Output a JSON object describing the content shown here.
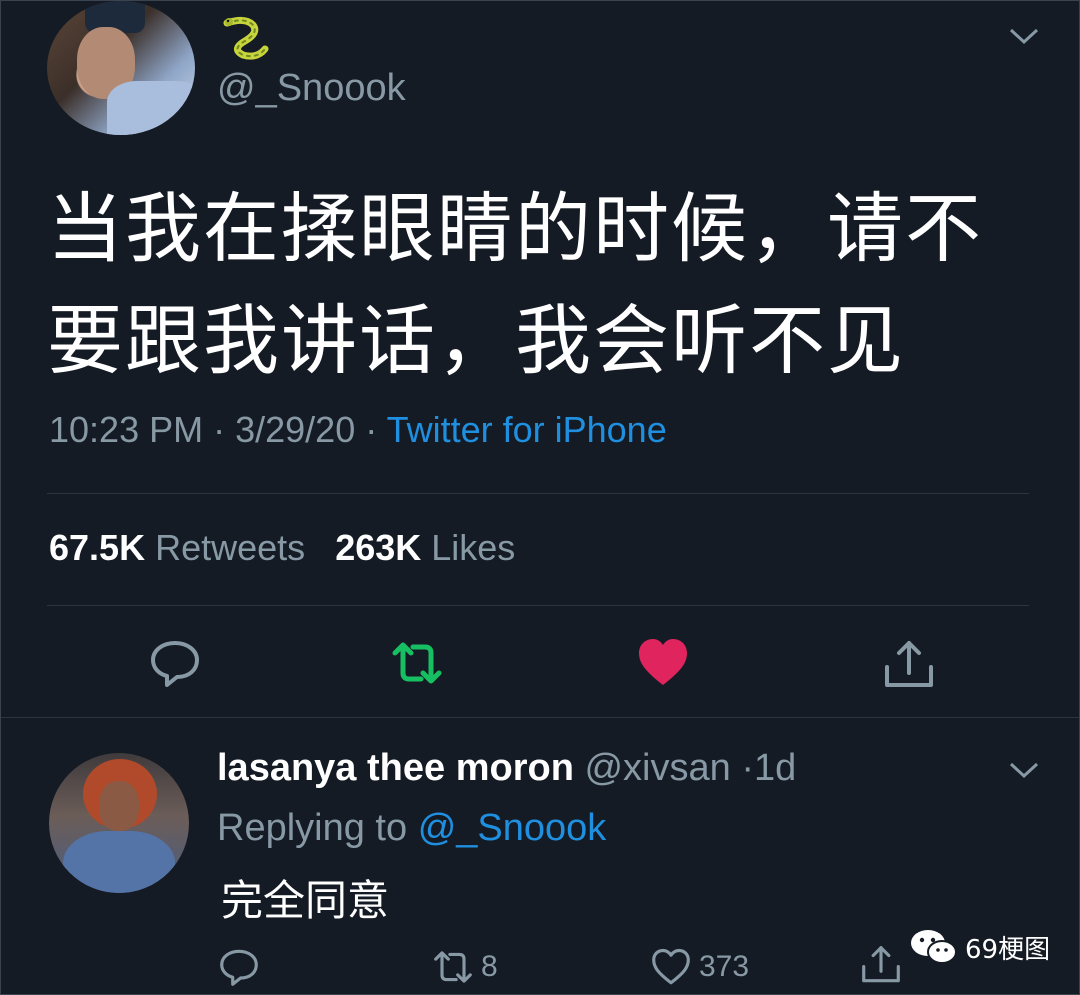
{
  "main_tweet": {
    "author_emoji": "snake",
    "handle": "@_Snoook",
    "text": "当我在揉眼睛的时候，请不要跟我讲话，我会听不见",
    "time": "10:23 PM",
    "date": "3/29/20",
    "client": "Twitter for iPhone",
    "retweets_count": "67.5K",
    "retweets_label": "Retweets",
    "likes_count": "263K",
    "likes_label": "Likes"
  },
  "reply": {
    "name": "lasanya thee moron",
    "handle": "@xivsan",
    "age": "1d",
    "replying_prefix": "Replying to",
    "replying_to": "@_Snoook",
    "text": "完全同意",
    "retweet_count": "8",
    "like_count": "373"
  },
  "watermark": {
    "label": "69梗图"
  },
  "colors": {
    "background": "#151b24",
    "accent": "#1f8fe0",
    "retweet_green": "#17bf63",
    "like_red": "#e0245e",
    "muted": "#8899a6"
  },
  "icons": [
    "chevron-down-icon",
    "reply-icon",
    "retweet-icon",
    "like-icon",
    "share-icon",
    "wechat-icon"
  ]
}
